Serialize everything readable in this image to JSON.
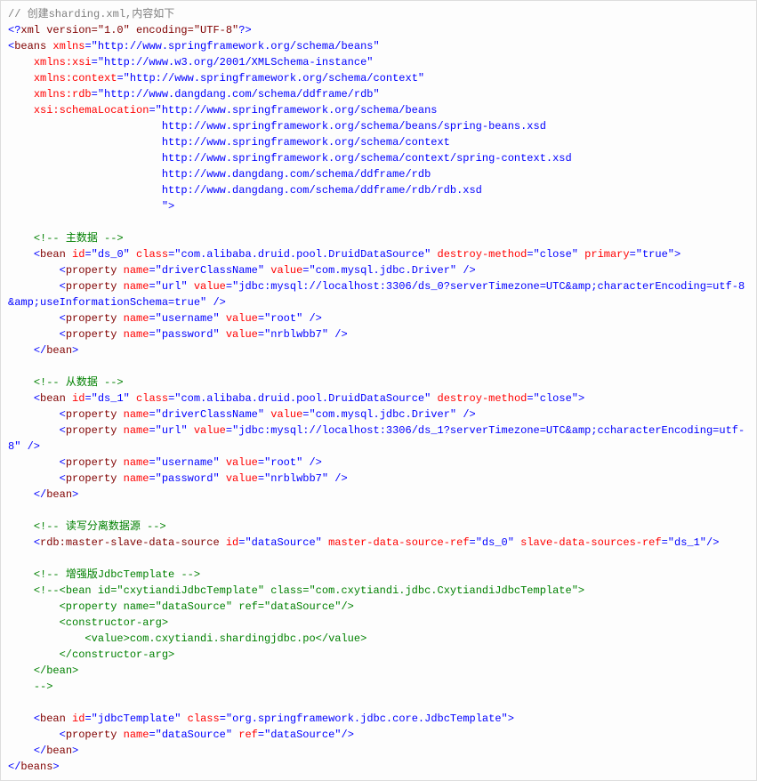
{
  "code": {
    "l1_a": "// 创建sharding.xml,内容如下",
    "l2_a": "<?",
    "l2_b": "xml version=\"1.0\" encoding=\"UTF-8\"",
    "l2_c": "?>",
    "l3_a": "<",
    "l3_b": "beans ",
    "l3_c": "xmlns",
    "l3_d": "=\"http://www.springframework.org/schema/beans\"",
    "l4_a": "    xmlns:xsi",
    "l4_b": "=\"http://www.w3.org/2001/XMLSchema-instance\"",
    "l5_a": "    xmlns:context",
    "l5_b": "=\"http://www.springframework.org/schema/context\"",
    "l6_a": "    xmlns:rdb",
    "l6_b": "=\"http://www.dangdang.com/schema/ddframe/rdb\"",
    "l7_a": "    xsi:schemaLocation",
    "l7_b": "=\"http://www.springframework.org/schema/beans",
    "l8_a": "                        http://www.springframework.org/schema/beans/spring-beans.xsd",
    "l9_a": "                        http://www.springframework.org/schema/context",
    "l10_a": "                        http://www.springframework.org/schema/context/spring-context.xsd",
    "l11_a": "                        http://www.dangdang.com/schema/ddframe/rdb",
    "l12_a": "                        http://www.dangdang.com/schema/ddframe/rdb/rdb.xsd",
    "l13_a": "                        \"",
    "l13_b": ">",
    "blank": "",
    "c_master_a": "    <!--",
    "c_master_b": " 主数据 ",
    "c_master_c": "-->",
    "m_bean_a": "    <",
    "m_bean_b": "bean ",
    "m_bean_c": "id",
    "m_bean_d": "=\"ds_0\"",
    "m_bean_e": " class",
    "m_bean_f": "=\"com.alibaba.druid.pool.DruidDataSource\"",
    "m_bean_g": " destroy-method",
    "m_bean_h": "=\"close\"",
    "m_bean_i": " primary",
    "m_bean_j": "=\"true\"",
    "m_bean_k": ">",
    "m_p1_a": "        <",
    "m_p1_b": "property ",
    "m_p1_c": "name",
    "m_p1_d": "=\"driverClassName\"",
    "m_p1_e": " value",
    "m_p1_f": "=\"com.mysql.jdbc.Driver\" ",
    "m_p1_g": "/>",
    "m_p2_a": "        <",
    "m_p2_b": "property ",
    "m_p2_c": "name",
    "m_p2_d": "=\"url\"",
    "m_p2_e": " value",
    "m_p2_f": "=\"jdbc:mysql://localhost:3306/ds_0?serverTimezone=UTC&amp;characterEncoding=utf-8&amp;useInformationSchema=true\" ",
    "m_p2_g": "/>",
    "m_p3_a": "        <",
    "m_p3_b": "property ",
    "m_p3_c": "name",
    "m_p3_d": "=\"username\"",
    "m_p3_e": " value",
    "m_p3_f": "=\"root\" ",
    "m_p3_g": "/>",
    "m_p4_a": "        <",
    "m_p4_b": "property ",
    "m_p4_c": "name",
    "m_p4_d": "=\"password\"",
    "m_p4_e": " value",
    "m_p4_f": "=\"nrblwbb7\" ",
    "m_p4_g": "/>",
    "m_end_a": "    </",
    "m_end_b": "bean",
    "m_end_c": ">",
    "c_slave_a": "    <!--",
    "c_slave_b": " 从数据 ",
    "c_slave_c": "-->",
    "s_bean_a": "    <",
    "s_bean_b": "bean ",
    "s_bean_c": "id",
    "s_bean_d": "=\"ds_1\"",
    "s_bean_e": " class",
    "s_bean_f": "=\"com.alibaba.druid.pool.DruidDataSource\"",
    "s_bean_g": " destroy-method",
    "s_bean_h": "=\"close\"",
    "s_bean_i": ">",
    "s_p1_a": "        <",
    "s_p1_b": "property ",
    "s_p1_c": "name",
    "s_p1_d": "=\"driverClassName\"",
    "s_p1_e": " value",
    "s_p1_f": "=\"com.mysql.jdbc.Driver\" ",
    "s_p1_g": "/>",
    "s_p2_a": "        <",
    "s_p2_b": "property ",
    "s_p2_c": "name",
    "s_p2_d": "=\"url\"",
    "s_p2_e": " value",
    "s_p2_f": "=\"jdbc:mysql://localhost:3306/ds_1?serverTimezone=UTC&amp;ccharacterEncoding=utf-8\" ",
    "s_p2_g": "/>",
    "s_p3_a": "        <",
    "s_p3_b": "property ",
    "s_p3_c": "name",
    "s_p3_d": "=\"username\"",
    "s_p3_e": " value",
    "s_p3_f": "=\"root\" ",
    "s_p3_g": "/>",
    "s_p4_a": "        <",
    "s_p4_b": "property ",
    "s_p4_c": "name",
    "s_p4_d": "=\"password\"",
    "s_p4_e": " value",
    "s_p4_f": "=\"nrblwbb7\" ",
    "s_p4_g": "/>",
    "s_end_a": "    </",
    "s_end_b": "bean",
    "s_end_c": ">",
    "c_rw_a": "    <!--",
    "c_rw_b": " 读写分离数据源 ",
    "c_rw_c": "-->",
    "rw_a": "    <",
    "rw_b": "rdb:master-slave-data-source ",
    "rw_c": "id",
    "rw_d": "=\"dataSource\"",
    "rw_e": " master-data-source-ref",
    "rw_f": "=\"ds_0\"",
    "rw_g": " slave-data-sources-ref",
    "rw_h": "=\"ds_1\"",
    "rw_i": "/>",
    "c_jt_a": "    <!--",
    "c_jt_b": " 增强版JdbcTemplate ",
    "c_jt_c": "-->",
    "cm1": "    <!--<bean id=\"cxytiandiJdbcTemplate\" class=\"com.cxytiandi.jdbc.CxytiandiJdbcTemplate\">",
    "cm2": "        <property name=\"dataSource\" ref=\"dataSource\"/>",
    "cm3": "        <constructor-arg>",
    "cm4": "            <value>com.cxytiandi.shardingjdbc.po</value>",
    "cm5": "        </constructor-arg>",
    "cm6": "    </bean>",
    "cm7": "    -->",
    "jt_a": "    <",
    "jt_b": "bean ",
    "jt_c": "id",
    "jt_d": "=\"jdbcTemplate\"",
    "jt_e": " class",
    "jt_f": "=\"org.springframework.jdbc.core.JdbcTemplate\"",
    "jt_g": ">",
    "jp_a": "        <",
    "jp_b": "property ",
    "jp_c": "name",
    "jp_d": "=\"dataSource\"",
    "jp_e": " ref",
    "jp_f": "=\"dataSource\"",
    "jp_g": "/>",
    "jt_end_a": "    </",
    "jt_end_b": "bean",
    "jt_end_c": ">",
    "root_end_a": "</",
    "root_end_b": "beans",
    "root_end_c": ">"
  }
}
